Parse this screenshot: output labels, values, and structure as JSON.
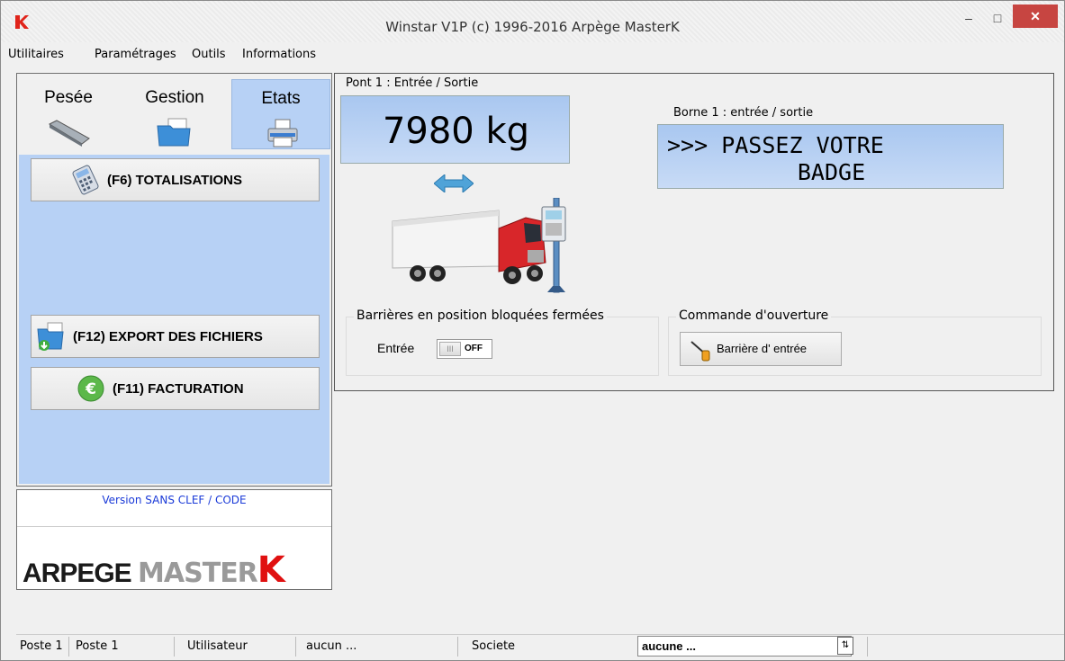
{
  "window": {
    "title": "Winstar V1P (c) 1996-2016 Arpège MasterK",
    "min": "–",
    "max": "□",
    "close": "✕"
  },
  "menu": [
    "Utilitaires",
    "Paramétrages",
    "Outils",
    "Informations"
  ],
  "tabs": [
    {
      "label": "Pesée",
      "icon": "scale-icon"
    },
    {
      "label": "Gestion",
      "icon": "folder-icon"
    },
    {
      "label": "Etats",
      "icon": "printer-icon",
      "active": true
    }
  ],
  "actions": {
    "totalisations": "(F6) TOTALISATIONS",
    "export": "(F12) EXPORT DES FICHIERS",
    "facturation": "(F11) FACTURATION"
  },
  "version": "Version SANS CLEF / CODE",
  "logo": {
    "part1": "ARPEGE",
    "part2": "MASTER",
    "part3": "K"
  },
  "pont": {
    "label": "Pont 1 : Entrée / Sortie",
    "weight": "7980  kg"
  },
  "borne": {
    "label": "Borne 1 : entrée / sortie",
    "line1": ">>> PASSEZ VOTRE",
    "line2": "BADGE"
  },
  "barrier_group": {
    "title": "Barrières en position bloquées fermées",
    "entree_label": "Entrée",
    "toggle_state": "OFF",
    "toggle_knob": "III"
  },
  "commande_group": {
    "title": "Commande d'ouverture",
    "button": "Barrière d' entrée"
  },
  "status": {
    "poste_label": "Poste 1",
    "poste_value": "Poste 1",
    "user_label": "Utilisateur",
    "user_value": "aucun ...",
    "societe_label": "Societe",
    "societe_value": "aucune ..."
  },
  "colors": {
    "panel_blue": "#b7d1f5",
    "close_red": "#c74541",
    "logo_red": "#e01010"
  }
}
